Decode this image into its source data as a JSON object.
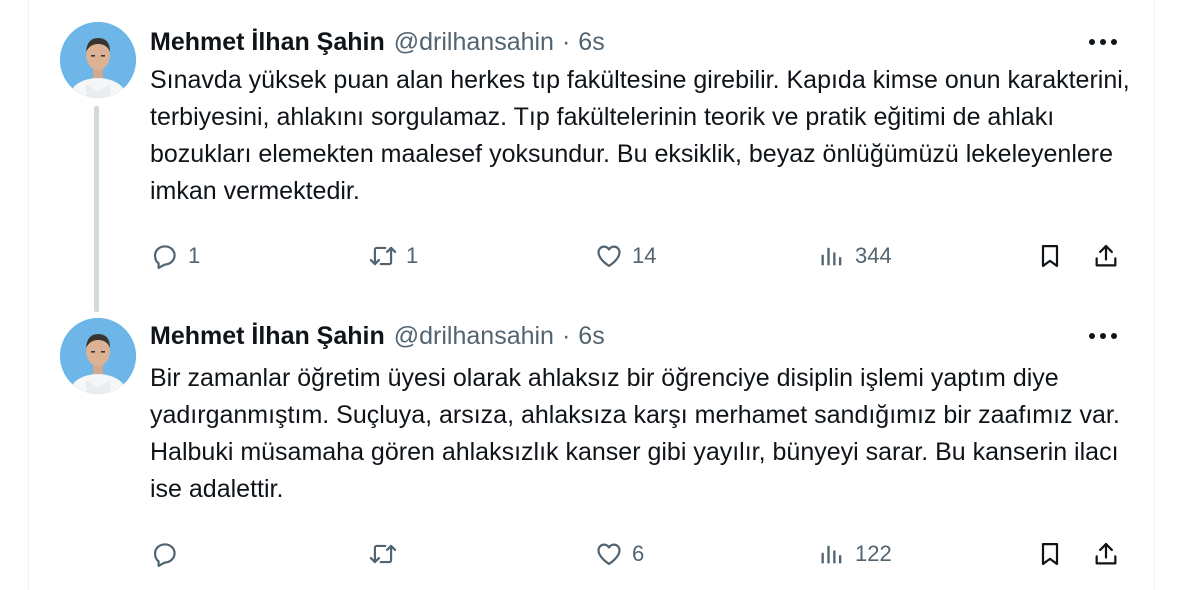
{
  "tweets": [
    {
      "author_name": "Mehmet İlhan Şahin",
      "handle": "@drilhansahin",
      "separator": "·",
      "time": "6s",
      "text": "Sınavda yüksek puan alan herkes tıp fakültesine girebilir. Kapıda kimse onun karakterini, terbiyesini, ahlakını sorgulamaz. Tıp fakültelerinin teorik ve pratik eğitimi de ahlakı bozukları elemekten maalesef yoksundur. Bu eksiklik, beyaz önlüğümüzü lekeleyenlere imkan vermektedir.",
      "replies": "1",
      "retweets": "1",
      "likes": "14",
      "views": "344"
    },
    {
      "author_name": "Mehmet İlhan Şahin",
      "handle": "@drilhansahin",
      "separator": "·",
      "time": "6s",
      "text": "Bir zamanlar öğretim üyesi olarak ahlaksız bir öğrenciye disiplin işlemi yaptım diye yadırganmıştım. Suçluya, arsıza, ahlaksıza karşı merhamet sandığımız bir zaafımız var. Halbuki müsamaha gören ahlaksızlık kanser gibi yayılır, bünyeyi sarar. Bu kanserin ilacı ise adalettir.",
      "replies": "",
      "retweets": "",
      "likes": "6",
      "views": "122"
    }
  ],
  "icons": {
    "reply": "reply-icon",
    "retweet": "retweet-icon",
    "like": "heart-icon",
    "views": "views-icon",
    "bookmark": "bookmark-icon",
    "share": "share-icon",
    "more": "more-icon"
  },
  "colors": {
    "text": "#0f1419",
    "secondary": "#536471",
    "thread_line": "#cfd9de",
    "avatar_bg": "#6fb6e8"
  }
}
